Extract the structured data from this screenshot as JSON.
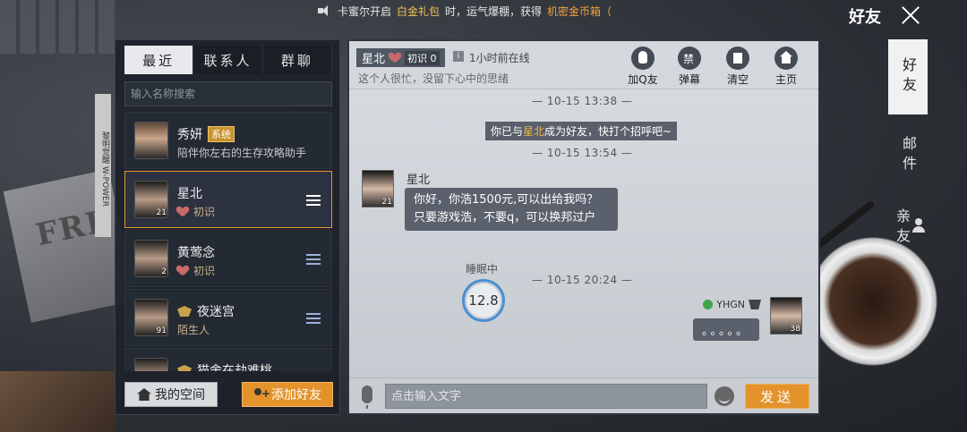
{
  "marquee": {
    "part1": "卡蜜尔开启",
    "highlight1": "白金礼包",
    "part2": "时，运气爆棚，获得",
    "highlight2": "机密金币箱（"
  },
  "page_title": "好友",
  "left_panel": {
    "tabs": [
      "最近",
      "联系人",
      "群聊"
    ],
    "search_placeholder": "输入名称搜索",
    "side_tag": "黎明觉醒 W-POWER",
    "contacts": [
      {
        "name": "秀妍",
        "badge": "系统",
        "sub": "陪伴你左右的生存攻略助手",
        "level": ""
      },
      {
        "name": "星北",
        "sub": "初识",
        "level": "21"
      },
      {
        "name": "黄莺念",
        "sub": "初识",
        "level": "2"
      },
      {
        "name": "夜迷宫",
        "sub": "陌生人",
        "level": "91"
      },
      {
        "name": "猫舍在劫难桃",
        "sub": "",
        "level": ""
      }
    ],
    "my_space_label": "我的空间",
    "add_friend_label": "添加好友"
  },
  "chat": {
    "friend_name": "星北",
    "intimacy": "初识 0",
    "online_status": "1小时前在线",
    "signature": "这个人很忙，没留下心中的思绪",
    "header_buttons": [
      "加Q友",
      "弹幕",
      "清空",
      "主页"
    ],
    "timestamps": [
      "— 10-15 13:38 —",
      "— 10-15 13:54 —",
      "— 10-15 20:24 —"
    ],
    "system_message": {
      "prefix": "你已与",
      "name": "星北",
      "suffix": "成为好友，快打个招呼吧~"
    },
    "incoming": {
      "sender": "星北",
      "level": "21",
      "text": "你好，你浩1500元,可以出给我吗？只要游戏浩，不要q，可以换邦过户"
    },
    "status_label": "睡眠中",
    "status_value": "12.8",
    "outgoing": {
      "sender": "YHGN",
      "level": "38",
      "text": "。。。。。"
    },
    "input_placeholder": "点击输入文字",
    "send_label": "发送"
  },
  "right_tabs": [
    "好友",
    "邮件",
    "亲友"
  ],
  "colors": {
    "accent": "#e4932c",
    "highlight": "#f2b648",
    "panel_dark": "#1c212a"
  }
}
